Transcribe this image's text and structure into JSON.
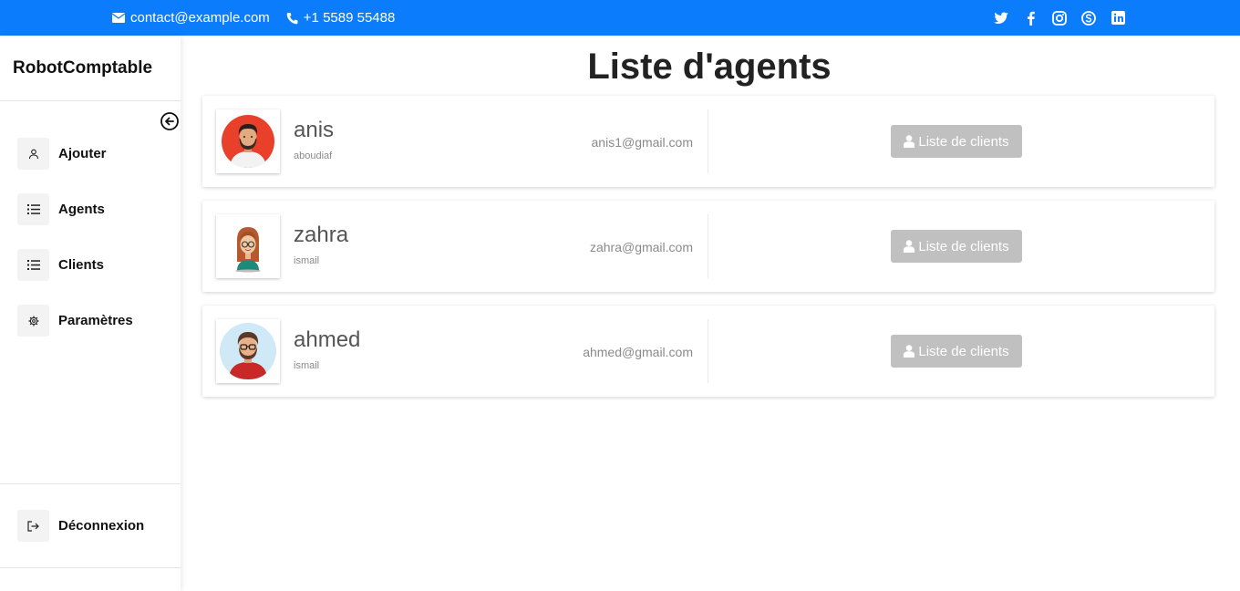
{
  "topbar": {
    "email": "contact@example.com",
    "phone": "+1 5589 55488",
    "social_icons": [
      "twitter-icon",
      "facebook-icon",
      "instagram-icon",
      "skype-icon",
      "linkedin-icon"
    ]
  },
  "sidebar": {
    "brand": "RobotComptable",
    "items": [
      {
        "label": "Ajouter",
        "icon": "user-icon"
      },
      {
        "label": "Agents",
        "icon": "list-icon"
      },
      {
        "label": "Clients",
        "icon": "list-icon"
      },
      {
        "label": "Paramètres",
        "icon": "gear-icon"
      }
    ],
    "logout": {
      "label": "Déconnexion",
      "icon": "logout-icon"
    }
  },
  "main": {
    "title": "Liste d'agents",
    "agents": [
      {
        "name": "anis",
        "sub": "aboudiaf",
        "email": "anis1@gmail.com",
        "button": "Liste de clients",
        "avatar": "man-beard-avatar"
      },
      {
        "name": "zahra",
        "sub": "ismail",
        "email": "zahra@gmail.com",
        "button": "Liste de clients",
        "avatar": "woman-glasses-avatar"
      },
      {
        "name": "ahmed",
        "sub": "ismail",
        "email": "ahmed@gmail.com",
        "button": "Liste de clients",
        "avatar": "man-glasses-avatar"
      }
    ]
  },
  "colors": {
    "topbar": "#0b7cfb",
    "button": "#c0c0c0",
    "avatar_red": "#e8402a",
    "avatar_blue": "#cfe9f7"
  }
}
